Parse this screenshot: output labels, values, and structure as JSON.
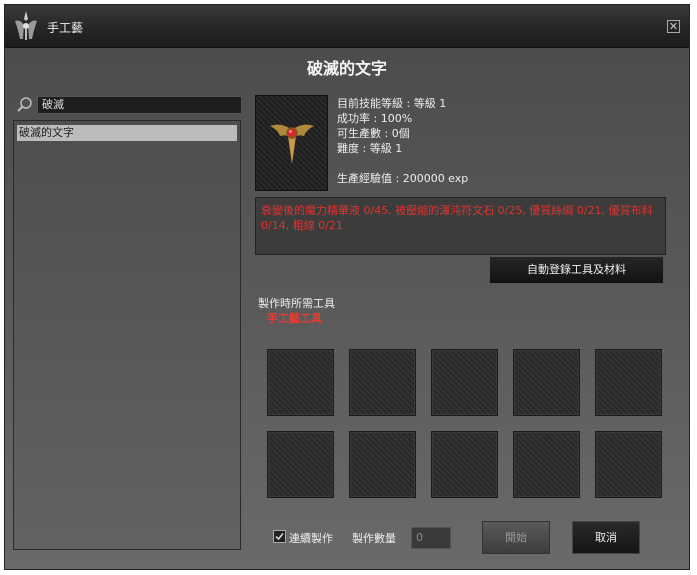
{
  "window": {
    "title": "手工藝",
    "icon": "guild-emblem-icon",
    "close_icon": "close-icon",
    "close_glyph": "✕"
  },
  "recipe": {
    "title": "破滅的文字"
  },
  "search": {
    "value": "破滅",
    "icon": "search-icon"
  },
  "recipe_list": {
    "items": [
      {
        "label": "破滅的文字",
        "selected": true
      }
    ]
  },
  "item": {
    "icon": "winged-amulet-icon",
    "skill_level": "目前技能等級 : 等級 1",
    "success_rate": "成功率 : 100%",
    "producible": "可生產數 : 0個",
    "difficulty": "難度 : 等級 1",
    "exp": "生產經驗值 : 200000 exp"
  },
  "materials": {
    "text": "衰變後的魔力精華液 0/45, 被壓縮的渾沌符文石 0/25, 優質絲綢 0/21, 優質布料 0/14, 粗線 0/21",
    "color": "#e0332e"
  },
  "buttons": {
    "auto_register": "自動登錄工具及材料",
    "start": "開始",
    "cancel": "取消"
  },
  "tools": {
    "label": "製作時所需工具",
    "item": "手工藝工具",
    "item_color": "#e83a30"
  },
  "slots": {
    "count": 10
  },
  "footer": {
    "continuous_label": "連續製作",
    "continuous_checked": true,
    "quantity_label": "製作數量",
    "quantity_value": "0"
  }
}
